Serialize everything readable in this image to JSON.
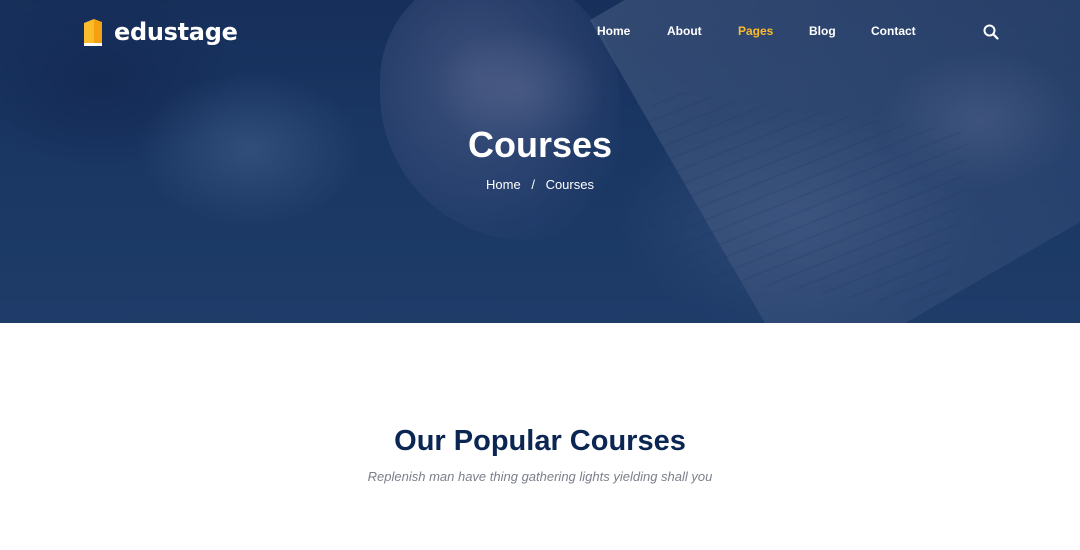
{
  "brand": {
    "name": "edustage",
    "accent_color": "#fbbb2b",
    "logo_icon": "book-icon"
  },
  "nav": {
    "items": [
      {
        "label": "Home",
        "active": false
      },
      {
        "label": "About",
        "active": false
      },
      {
        "label": "Pages",
        "active": true
      },
      {
        "label": "Blog",
        "active": false
      },
      {
        "label": "Contact",
        "active": false
      }
    ],
    "search_icon": "search-icon"
  },
  "hero": {
    "title": "Courses",
    "breadcrumb": {
      "home": "Home",
      "separator": "/",
      "current": "Courses"
    }
  },
  "section": {
    "title": "Our Popular Courses",
    "subtitle": "Replenish man have thing gathering lights yielding shall you",
    "title_color": "#0b2653"
  }
}
